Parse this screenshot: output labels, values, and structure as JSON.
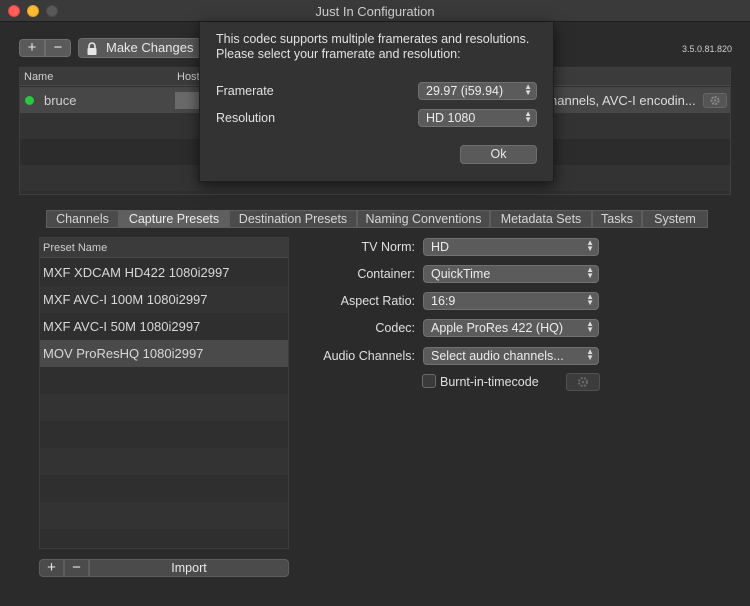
{
  "window": {
    "title": "Just In Configuration"
  },
  "toolbar": {
    "add_label": "+",
    "remove_label": "−",
    "make_changes_label": "Make Changes",
    "version": "3.5.0.81.820"
  },
  "channels_table": {
    "columns": [
      "Name",
      "Host"
    ],
    "rows": [
      {
        "name": "bruce",
        "status_color": "#28c840",
        "description": "hannels, AVC-I encodin..."
      }
    ]
  },
  "dialog": {
    "message_line1": "This codec supports multiple framerates and resolutions.",
    "message_line2": "Please select your framerate and resolution:",
    "framerate_label": "Framerate",
    "framerate_value": "29.97 (i59.94)",
    "resolution_label": "Resolution",
    "resolution_value": "HD 1080",
    "ok_label": "Ok"
  },
  "tabs": [
    {
      "label": "Channels"
    },
    {
      "label": "Capture Presets",
      "active": true
    },
    {
      "label": "Destination Presets"
    },
    {
      "label": "Naming Conventions"
    },
    {
      "label": "Metadata Sets"
    },
    {
      "label": "Tasks"
    },
    {
      "label": "System"
    }
  ],
  "presets": {
    "header": "Preset Name",
    "items": [
      {
        "name": "MXF XDCAM HD422 1080i2997"
      },
      {
        "name": "MXF AVC-I 100M 1080i2997"
      },
      {
        "name": "MXF AVC-I 50M 1080i2997"
      },
      {
        "name": "MOV ProResHQ 1080i2997",
        "selected": true
      }
    ],
    "add_label": "+",
    "remove_label": "−",
    "import_label": "Import"
  },
  "settings": {
    "tv_norm_label": "TV Norm:",
    "tv_norm_value": "HD",
    "container_label": "Container:",
    "container_value": "QuickTime",
    "aspect_label": "Aspect Ratio:",
    "aspect_value": "16:9",
    "codec_label": "Codec:",
    "codec_value": "Apple ProRes 422 (HQ)",
    "audio_label": "Audio Channels:",
    "audio_value": "Select audio channels...",
    "burnt_label": "Burnt-in-timecode",
    "burnt_checked": false
  },
  "colors": {
    "accent_green": "#28c840",
    "background": "#2b2b2b"
  }
}
